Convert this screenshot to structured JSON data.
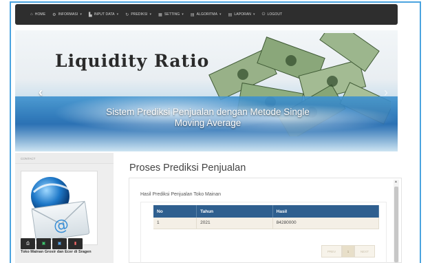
{
  "nav": {
    "items": [
      {
        "label": "HOME",
        "icon": "home-icon",
        "glyph": "⌂",
        "caret": false
      },
      {
        "label": "INFORMASI",
        "icon": "gear-icon",
        "glyph": "⚙",
        "caret": true
      },
      {
        "label": "INPUT DATA",
        "icon": "file-icon",
        "glyph": "▙",
        "caret": true
      },
      {
        "label": "PREDIKSI",
        "icon": "refresh-icon",
        "glyph": "↻",
        "caret": true
      },
      {
        "label": "SETTING",
        "icon": "grid-icon",
        "glyph": "▦",
        "caret": true
      },
      {
        "label": "ALGORITMA",
        "icon": "list-icon",
        "glyph": "▤",
        "caret": true
      },
      {
        "label": "LAPORAN",
        "icon": "report-icon",
        "glyph": "▤",
        "caret": true
      },
      {
        "label": "LOGOUT",
        "icon": "power-icon",
        "glyph": "⏻",
        "caret": false
      }
    ],
    "caret_glyph": "▾"
  },
  "carousel": {
    "title": "Liquidity Ratio",
    "caption": "Sistem Prediksi Penjualan dengan Metode Single Moving Average",
    "prev_glyph": "‹",
    "next_glyph": "›"
  },
  "sidebar": {
    "heading": "CONTACT",
    "text": "Toko Mainan Grosir dan Ecer di Sragen"
  },
  "main": {
    "page_title": "Proses Prediksi Penjualan",
    "panel_title": "Hasil Prediksi Penjualan Toko Mainan",
    "table": {
      "headers": [
        "No",
        "Tahun",
        "Hasil"
      ],
      "rows": [
        [
          "1",
          "2021",
          "84280000"
        ]
      ]
    },
    "export_buttons": [
      {
        "icon": "print-icon",
        "glyph": "⎙"
      },
      {
        "icon": "excel-icon",
        "glyph": "▣"
      },
      {
        "icon": "word-icon",
        "glyph": "▣"
      },
      {
        "icon": "pdf-icon",
        "glyph": "▮"
      }
    ],
    "pagination": {
      "prev": "PREV",
      "current": "1",
      "next": "NEXT"
    }
  },
  "colors": {
    "navbar": "#2e2e2e",
    "frame_border": "#4aa3df",
    "table_header": "#2f5f8f",
    "table_row": "#f4efe6"
  }
}
